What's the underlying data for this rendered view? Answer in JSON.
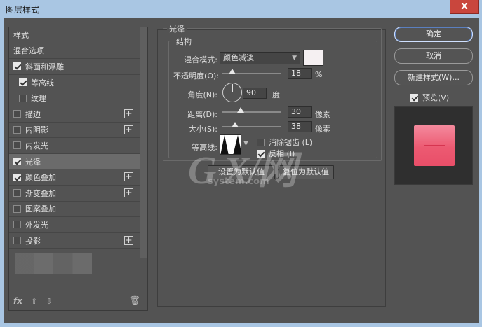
{
  "window": {
    "title": "图层样式",
    "close": "X"
  },
  "style_list": {
    "items": [
      {
        "label": "样式",
        "checkbox": false,
        "checked": false,
        "plus": false,
        "selected": false,
        "indent": false
      },
      {
        "label": "混合选项",
        "checkbox": false,
        "checked": false,
        "plus": false,
        "selected": false,
        "indent": false
      },
      {
        "label": "斜面和浮雕",
        "checkbox": true,
        "checked": true,
        "plus": false,
        "selected": false,
        "indent": false
      },
      {
        "label": "等高线",
        "checkbox": true,
        "checked": true,
        "plus": false,
        "selected": false,
        "indent": true
      },
      {
        "label": "纹理",
        "checkbox": true,
        "checked": false,
        "plus": false,
        "selected": false,
        "indent": true
      },
      {
        "label": "描边",
        "checkbox": true,
        "checked": false,
        "plus": true,
        "selected": false,
        "indent": false
      },
      {
        "label": "内阴影",
        "checkbox": true,
        "checked": false,
        "plus": true,
        "selected": false,
        "indent": false
      },
      {
        "label": "内发光",
        "checkbox": true,
        "checked": false,
        "plus": false,
        "selected": false,
        "indent": false
      },
      {
        "label": "光泽",
        "checkbox": true,
        "checked": true,
        "plus": false,
        "selected": true,
        "indent": false
      },
      {
        "label": "颜色叠加",
        "checkbox": true,
        "checked": true,
        "plus": true,
        "selected": false,
        "indent": false
      },
      {
        "label": "渐变叠加",
        "checkbox": true,
        "checked": false,
        "plus": true,
        "selected": false,
        "indent": false
      },
      {
        "label": "图案叠加",
        "checkbox": true,
        "checked": false,
        "plus": false,
        "selected": false,
        "indent": false
      },
      {
        "label": "外发光",
        "checkbox": true,
        "checked": false,
        "plus": false,
        "selected": false,
        "indent": false
      },
      {
        "label": "投影",
        "checkbox": true,
        "checked": false,
        "plus": true,
        "selected": false,
        "indent": false
      }
    ],
    "footer": {
      "fx": "fx",
      "up": "⇧",
      "down": "⇩",
      "trash": "🗑"
    }
  },
  "satin": {
    "group_title": "光泽",
    "structure_title": "结构",
    "blend_mode_label": "混合模式:",
    "blend_mode_value": "颜色减淡",
    "color": "#f5f0f2",
    "opacity_label": "不透明度(O):",
    "opacity_value": "18",
    "opacity_unit": "%",
    "opacity_percent": 18,
    "angle_label": "角度(N):",
    "angle_value": "90",
    "angle_unit": "度",
    "distance_label": "距离(D):",
    "distance_value": "30",
    "distance_unit": "像素",
    "size_label": "大小(S):",
    "size_value": "38",
    "size_unit": "像素",
    "contour_label": "等高线:",
    "anti_alias_label": "消除锯齿 (L)",
    "anti_alias_checked": false,
    "invert_label": "反相 (I)",
    "invert_checked": true,
    "make_default": "设置为默认值",
    "reset_default": "复位为默认值"
  },
  "actions": {
    "ok": "确定",
    "cancel": "取消",
    "new_style": "新建样式(W)...",
    "preview_label": "预览(V)",
    "preview_checked": true,
    "preview_color": "#ec5a72"
  },
  "watermark": {
    "main": "G X/网",
    "sub": "system.com"
  }
}
